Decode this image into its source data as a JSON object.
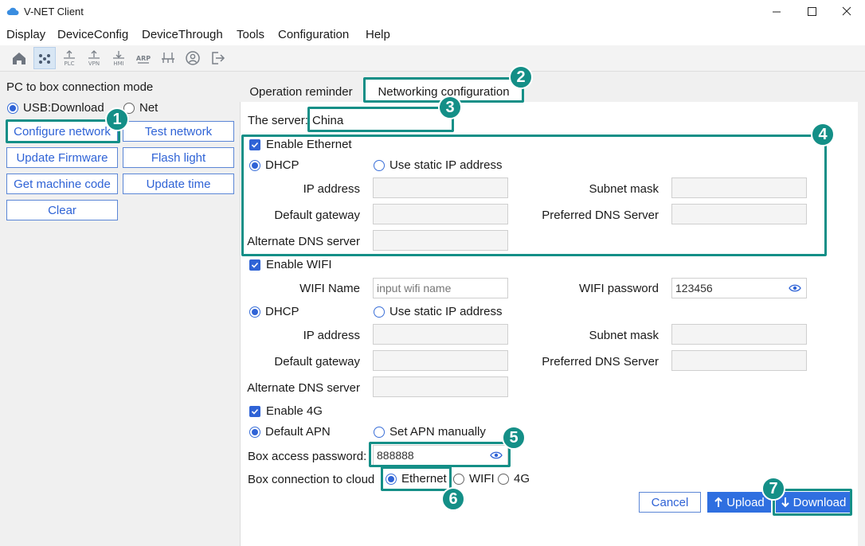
{
  "window": {
    "title": "V-NET Client"
  },
  "menu": [
    "Display",
    "DeviceConfig",
    "DeviceThrough",
    "Tools",
    "Configuration",
    "Help"
  ],
  "toolbar": {
    "icons": [
      "home-icon",
      "network-nodes-icon",
      "plc-icon",
      "vpn-icon",
      "hmi-icon",
      "arp-icon",
      "router-icon",
      "user-icon",
      "logout-icon"
    ],
    "labels": {
      "plc": "PLC",
      "vpn": "VPN",
      "hmi": "HMI",
      "arp": "ARP"
    },
    "active_index": 1
  },
  "left": {
    "title": "PC to box connection mode",
    "mode_usb": "USB:Download",
    "mode_net": "Net",
    "selected_mode": "USB:Download",
    "buttons": {
      "configure": "Configure network",
      "test": "Test network",
      "firmware": "Update Firmware",
      "flash": "Flash light",
      "machine_code": "Get machine code",
      "update_time": "Update time",
      "clear": "Clear"
    }
  },
  "tabs": {
    "operation": "Operation reminder",
    "networking": "Networking configuration",
    "active": "Networking configuration"
  },
  "form": {
    "server_label": "The server:",
    "server_value": "China",
    "ethernet": {
      "enable_label": "Enable Ethernet",
      "enabled": true,
      "dhcp": "DHCP",
      "static": "Use static IP address",
      "selected": "DHCP",
      "ip": "IP address",
      "subnet": "Subnet mask",
      "gateway": "Default gateway",
      "dns_pref": "Preferred DNS Server",
      "dns_alt": "Alternate DNS server"
    },
    "wifi": {
      "enable_label": "Enable WIFI",
      "enabled": true,
      "name_label": "WIFI Name",
      "name_placeholder": "input wifi name",
      "password_label": "WIFI password",
      "password_value": "123456",
      "dhcp": "DHCP",
      "static": "Use static IP address",
      "selected": "DHCP",
      "ip": "IP address",
      "subnet": "Subnet mask",
      "gateway": "Default gateway",
      "dns_pref": "Preferred DNS Server",
      "dns_alt": "Alternate DNS server"
    },
    "cell": {
      "enable_label": "Enable 4G",
      "enabled": true,
      "default_apn": "Default APN",
      "manual_apn": "Set APN manually",
      "selected": "Default APN"
    },
    "box_password_label": "Box access password:",
    "box_password_value": "888888",
    "cloud_label": "Box connection to cloud",
    "cloud_options": [
      "Ethernet",
      "WIFI",
      "4G"
    ],
    "cloud_selected": "Ethernet"
  },
  "actions": {
    "cancel": "Cancel",
    "upload": "Upload",
    "download": "Download"
  },
  "callouts": [
    "1",
    "2",
    "3",
    "4",
    "5",
    "6",
    "7"
  ],
  "colors": {
    "accent": "#2f63d6",
    "callout": "#148f87",
    "primary_button": "#2f6fe0"
  }
}
